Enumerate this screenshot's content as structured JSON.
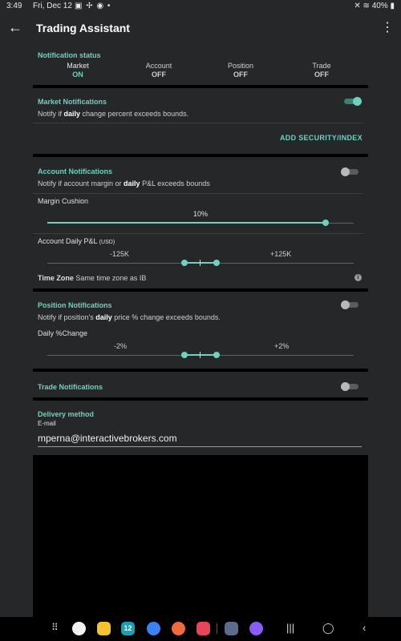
{
  "status_bar": {
    "time": "3:49",
    "date": "Fri, Dec 12",
    "left_icons": [
      "image-icon",
      "pinwheel-icon",
      "circle-icon",
      "dot-icon"
    ],
    "battery": "40%",
    "right_icons": [
      "mute-icon",
      "wifi-icon",
      "battery-icon"
    ]
  },
  "app_bar": {
    "title": "Trading Assistant",
    "back_icon": "arrow-left-icon",
    "menu_icon": "more-vert-icon"
  },
  "notification_status": {
    "heading": "Notification status",
    "items": [
      {
        "label": "Market",
        "value": "ON"
      },
      {
        "label": "Account",
        "value": "OFF"
      },
      {
        "label": "Position",
        "value": "OFF"
      },
      {
        "label": "Trade",
        "value": "OFF"
      }
    ]
  },
  "market": {
    "title": "Market Notifications",
    "desc_pre": "Notify if ",
    "desc_bold": "daily",
    "desc_post": " change percent exceeds bounds.",
    "enabled": true,
    "add_button": "ADD SECURITY/INDEX"
  },
  "account": {
    "title": "Account Notifications",
    "desc_pre": "Notify if account margin or ",
    "desc_bold": "daily",
    "desc_post": " P&L exceeds bounds",
    "enabled": false,
    "margin_label": "Margin Cushion",
    "margin_value": "10%",
    "margin_fraction": 0.1,
    "pnl_label": "Account Daily P&L",
    "pnl_unit": "(USD)",
    "pnl_low": "-125K",
    "pnl_high": "+125K",
    "timezone_label": "Time Zone",
    "timezone_value": "Same time zone as IB",
    "info_glyph": "i"
  },
  "position": {
    "title": "Position Notifications",
    "desc_pre": "Notify if position's ",
    "desc_bold": "daily",
    "desc_post": " price % change exceeds bounds.",
    "enabled": false,
    "change_label": "Daily %Change",
    "low": "-2%",
    "high": "+2%"
  },
  "trade": {
    "title": "Trade Notifications",
    "enabled": false
  },
  "delivery": {
    "title": "Delivery method",
    "email_label": "E-mail",
    "email_value": "mperna@interactivebrokers.com"
  },
  "nav_bar": {
    "apps": [
      "app-drawer-icon",
      "chrome-icon",
      "files-icon",
      "calendar-icon",
      "messages-icon",
      "contacts-icon",
      "screen-recorder-icon",
      "settings-icon",
      "internet-icon"
    ],
    "calendar_day": "12",
    "buttons": [
      "recents-icon",
      "home-icon",
      "back-icon"
    ],
    "colors": {
      "accent": "#6fd1c0",
      "surface": "#252729",
      "background": "#000000"
    }
  }
}
